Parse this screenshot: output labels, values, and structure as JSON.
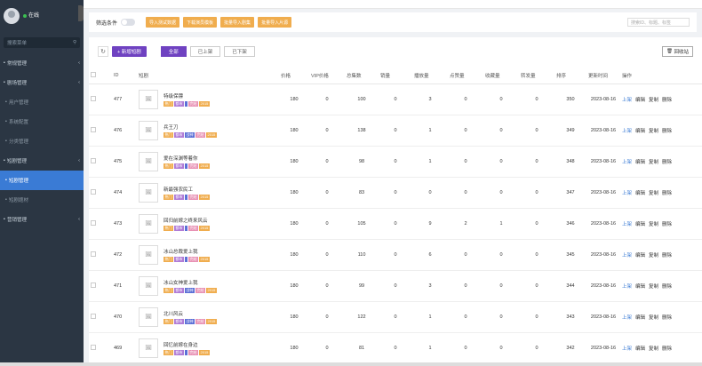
{
  "sidebar": {
    "user_name": "",
    "status": "在线",
    "search_placeholder": "搜索菜单",
    "menu": [
      {
        "label": "常规管理",
        "type": "parent"
      },
      {
        "label": "剧场管理",
        "type": "parent"
      },
      {
        "label": "用户管理",
        "type": "sub"
      },
      {
        "label": "系统配置",
        "type": "sub"
      },
      {
        "label": "分类管理",
        "type": "sub"
      },
      {
        "label": "短剧管理",
        "type": "parent"
      },
      {
        "label": "短剧管理",
        "type": "active"
      },
      {
        "label": "短剧题材",
        "type": "sub"
      },
      {
        "label": "营销管理",
        "type": "parent"
      }
    ]
  },
  "filterbar": {
    "label": "筛选条件",
    "buttons": [
      "导入测试数据",
      "下载演员模板",
      "批量导入剧集",
      "批量导入片源"
    ],
    "search_placeholder": "搜索ID、标题、标签"
  },
  "toolbar": {
    "add_label": "+ 新增短剧",
    "tabs": [
      "全部",
      "已上架",
      "已下架"
    ],
    "recycle_label": "回收站"
  },
  "table": {
    "headers": [
      "",
      "ID",
      "短剧",
      "价格",
      "VIP价格",
      "总集数",
      "销量",
      "播放量",
      "点赞量",
      "收藏量",
      "转发量",
      "排序",
      "更新时间",
      "操作"
    ],
    "rows": [
      {
        "id": "477",
        "title": "特级保镖",
        "tags": [
          "热门",
          "都市",
          "",
          "完结",
          "2015"
        ],
        "price": "180",
        "vip": "0",
        "episodes": "100",
        "sales": "0",
        "plays": "3",
        "likes": "0",
        "favs": "0",
        "shares": "0",
        "sort": "350",
        "time": "2023-08-16"
      },
      {
        "id": "476",
        "title": "兵王刀",
        "tags": [
          "热门",
          "都市",
          "战神",
          "完结",
          "2015"
        ],
        "price": "180",
        "vip": "0",
        "episodes": "138",
        "sales": "0",
        "plays": "1",
        "likes": "0",
        "favs": "0",
        "shares": "0",
        "sort": "349",
        "time": "2023-08-16"
      },
      {
        "id": "475",
        "title": "爱在深渊等着你",
        "tags": [
          "热门",
          "都市",
          "",
          "完结",
          "2015"
        ],
        "price": "180",
        "vip": "0",
        "episodes": "98",
        "sales": "0",
        "plays": "1",
        "likes": "0",
        "favs": "0",
        "shares": "0",
        "sort": "348",
        "time": "2023-08-16"
      },
      {
        "id": "474",
        "title": "新最强农民工",
        "tags": [
          "热门",
          "都市",
          "",
          "完结",
          "2015"
        ],
        "price": "180",
        "vip": "0",
        "episodes": "83",
        "sales": "0",
        "plays": "0",
        "likes": "0",
        "favs": "0",
        "shares": "0",
        "sort": "347",
        "time": "2023-08-16"
      },
      {
        "id": "473",
        "title": "回归前嫁之终来风云",
        "tags": [
          "热门",
          "都市",
          "",
          "完结",
          "2015"
        ],
        "price": "180",
        "vip": "0",
        "episodes": "105",
        "sales": "0",
        "plays": "9",
        "likes": "2",
        "favs": "1",
        "shares": "0",
        "sort": "346",
        "time": "2023-08-16"
      },
      {
        "id": "472",
        "title": "冰山总裁爱上我",
        "tags": [
          "热门",
          "都市",
          "",
          "完结",
          "2015"
        ],
        "price": "180",
        "vip": "0",
        "episodes": "110",
        "sales": "0",
        "plays": "6",
        "likes": "0",
        "favs": "0",
        "shares": "0",
        "sort": "345",
        "time": "2023-08-16"
      },
      {
        "id": "471",
        "title": "冰山女神爱上我",
        "tags": [
          "热门",
          "都市",
          "战神",
          "完结",
          "2015"
        ],
        "price": "180",
        "vip": "0",
        "episodes": "99",
        "sales": "0",
        "plays": "3",
        "likes": "0",
        "favs": "0",
        "shares": "0",
        "sort": "344",
        "time": "2023-08-16"
      },
      {
        "id": "470",
        "title": "北川风云",
        "tags": [
          "热门",
          "都市",
          "战神",
          "完结",
          "2015"
        ],
        "price": "180",
        "vip": "0",
        "episodes": "122",
        "sales": "0",
        "plays": "1",
        "likes": "0",
        "favs": "0",
        "shares": "0",
        "sort": "343",
        "time": "2023-08-16"
      },
      {
        "id": "469",
        "title": "回忆前嫁在身边",
        "tags": [
          "热门",
          "都市",
          "",
          "完结",
          "2015"
        ],
        "price": "180",
        "vip": "0",
        "episodes": "81",
        "sales": "0",
        "plays": "1",
        "likes": "0",
        "favs": "0",
        "shares": "0",
        "sort": "342",
        "time": "2023-08-16"
      }
    ],
    "ops": [
      "上架",
      "编辑",
      "复制",
      "删除"
    ]
  }
}
